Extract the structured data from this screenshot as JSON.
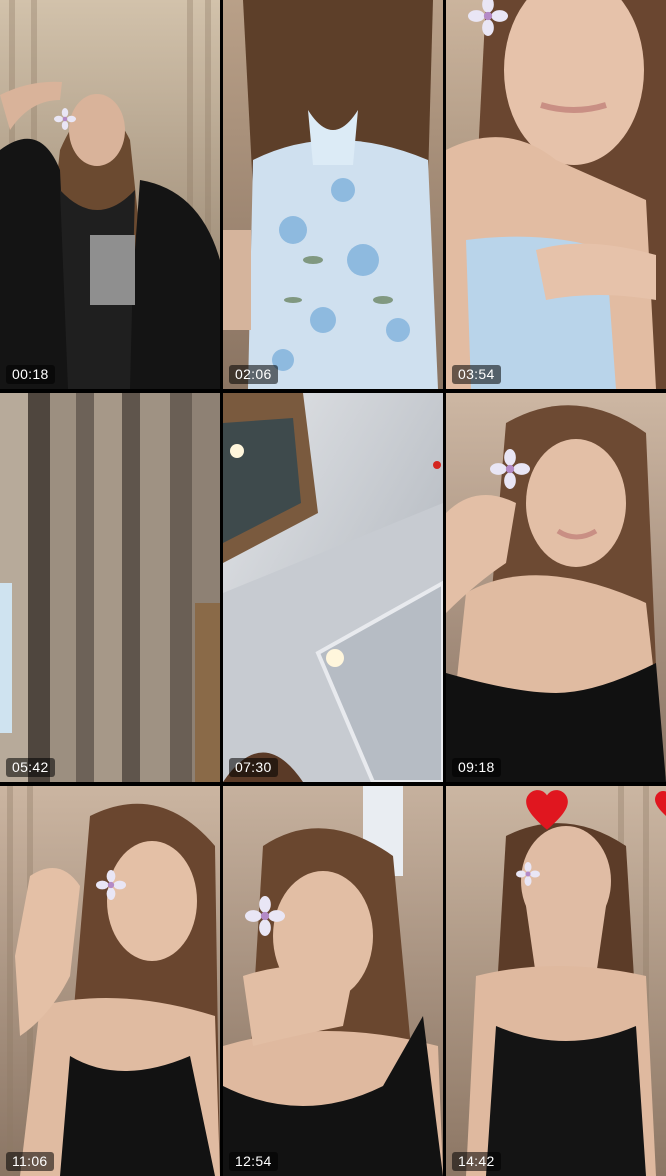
{
  "gallery": {
    "items": [
      {
        "duration": "00:18",
        "scene": {
          "bg": [
            "#c8b9a3",
            "#8c7a66"
          ],
          "curtain": "#b9a68e",
          "hair": "#6b4a30",
          "skin": "#d9b39a",
          "outfit": "#141414"
        }
      },
      {
        "duration": "02:06",
        "scene": {
          "bg": [
            "#bda58c",
            "#8a7462"
          ],
          "curtain": "#a88f78",
          "hair": "#5d3f29",
          "skin": "#e1bfa8",
          "outfit": "#cfe0ef"
        }
      },
      {
        "duration": "03:54",
        "scene": {
          "bg": [
            "#cdb7a1",
            "#8f7a66"
          ],
          "curtain": "#b39c85",
          "hair": "#6a4630",
          "skin": "#e6c2aa",
          "outfit": "#b9d4ea"
        }
      },
      {
        "duration": "05:42",
        "scene": {
          "bg": [
            "#b7aa9a",
            "#5a4f45"
          ],
          "curtain": "#9c8f80",
          "hair": "#4a3524",
          "skin": "#d6b29a",
          "outfit": "#6a5f55"
        }
      },
      {
        "duration": "07:30",
        "scene": {
          "bg": [
            "#d8dbe0",
            "#9aa0a8"
          ],
          "curtain": "#c7cbd1",
          "hair": "#5a3a27",
          "skin": "#d9b59d",
          "outfit": "#7a5a3e"
        }
      },
      {
        "duration": "09:18",
        "scene": {
          "bg": [
            "#c9b3a0",
            "#8b7464"
          ],
          "curtain": "#b59c88",
          "hair": "#6d4a33",
          "skin": "#e3bfa6",
          "outfit": "#111111"
        }
      },
      {
        "duration": "11:06",
        "scene": {
          "bg": [
            "#c7b19d",
            "#8a7564"
          ],
          "curtain": "#b39a86",
          "hair": "#6a462f",
          "skin": "#e4c0a6",
          "outfit": "#121212"
        }
      },
      {
        "duration": "12:54",
        "scene": {
          "bg": [
            "#c2ad9a",
            "#86705f"
          ],
          "curtain": "#b09984",
          "hair": "#6a472f",
          "skin": "#e2bea4",
          "outfit": "#121212"
        }
      },
      {
        "duration": "14:42",
        "scene": {
          "bg": [
            "#c9b4a0",
            "#8c7664"
          ],
          "curtain": "#b39c88",
          "hair": "#5c3c28",
          "skin": "#e0bca4",
          "outfit": "#141414"
        }
      }
    ]
  },
  "icons": {
    "flower": "flower-sticker-icon",
    "heart": "heart-sticker-icon"
  },
  "colors": {
    "background": "#000000",
    "duration_text": "#ffffff",
    "duration_bg": "rgba(0,0,0,0.55)",
    "sticker_heart": "#e0161f",
    "sticker_flower": "#e9e6f5"
  }
}
